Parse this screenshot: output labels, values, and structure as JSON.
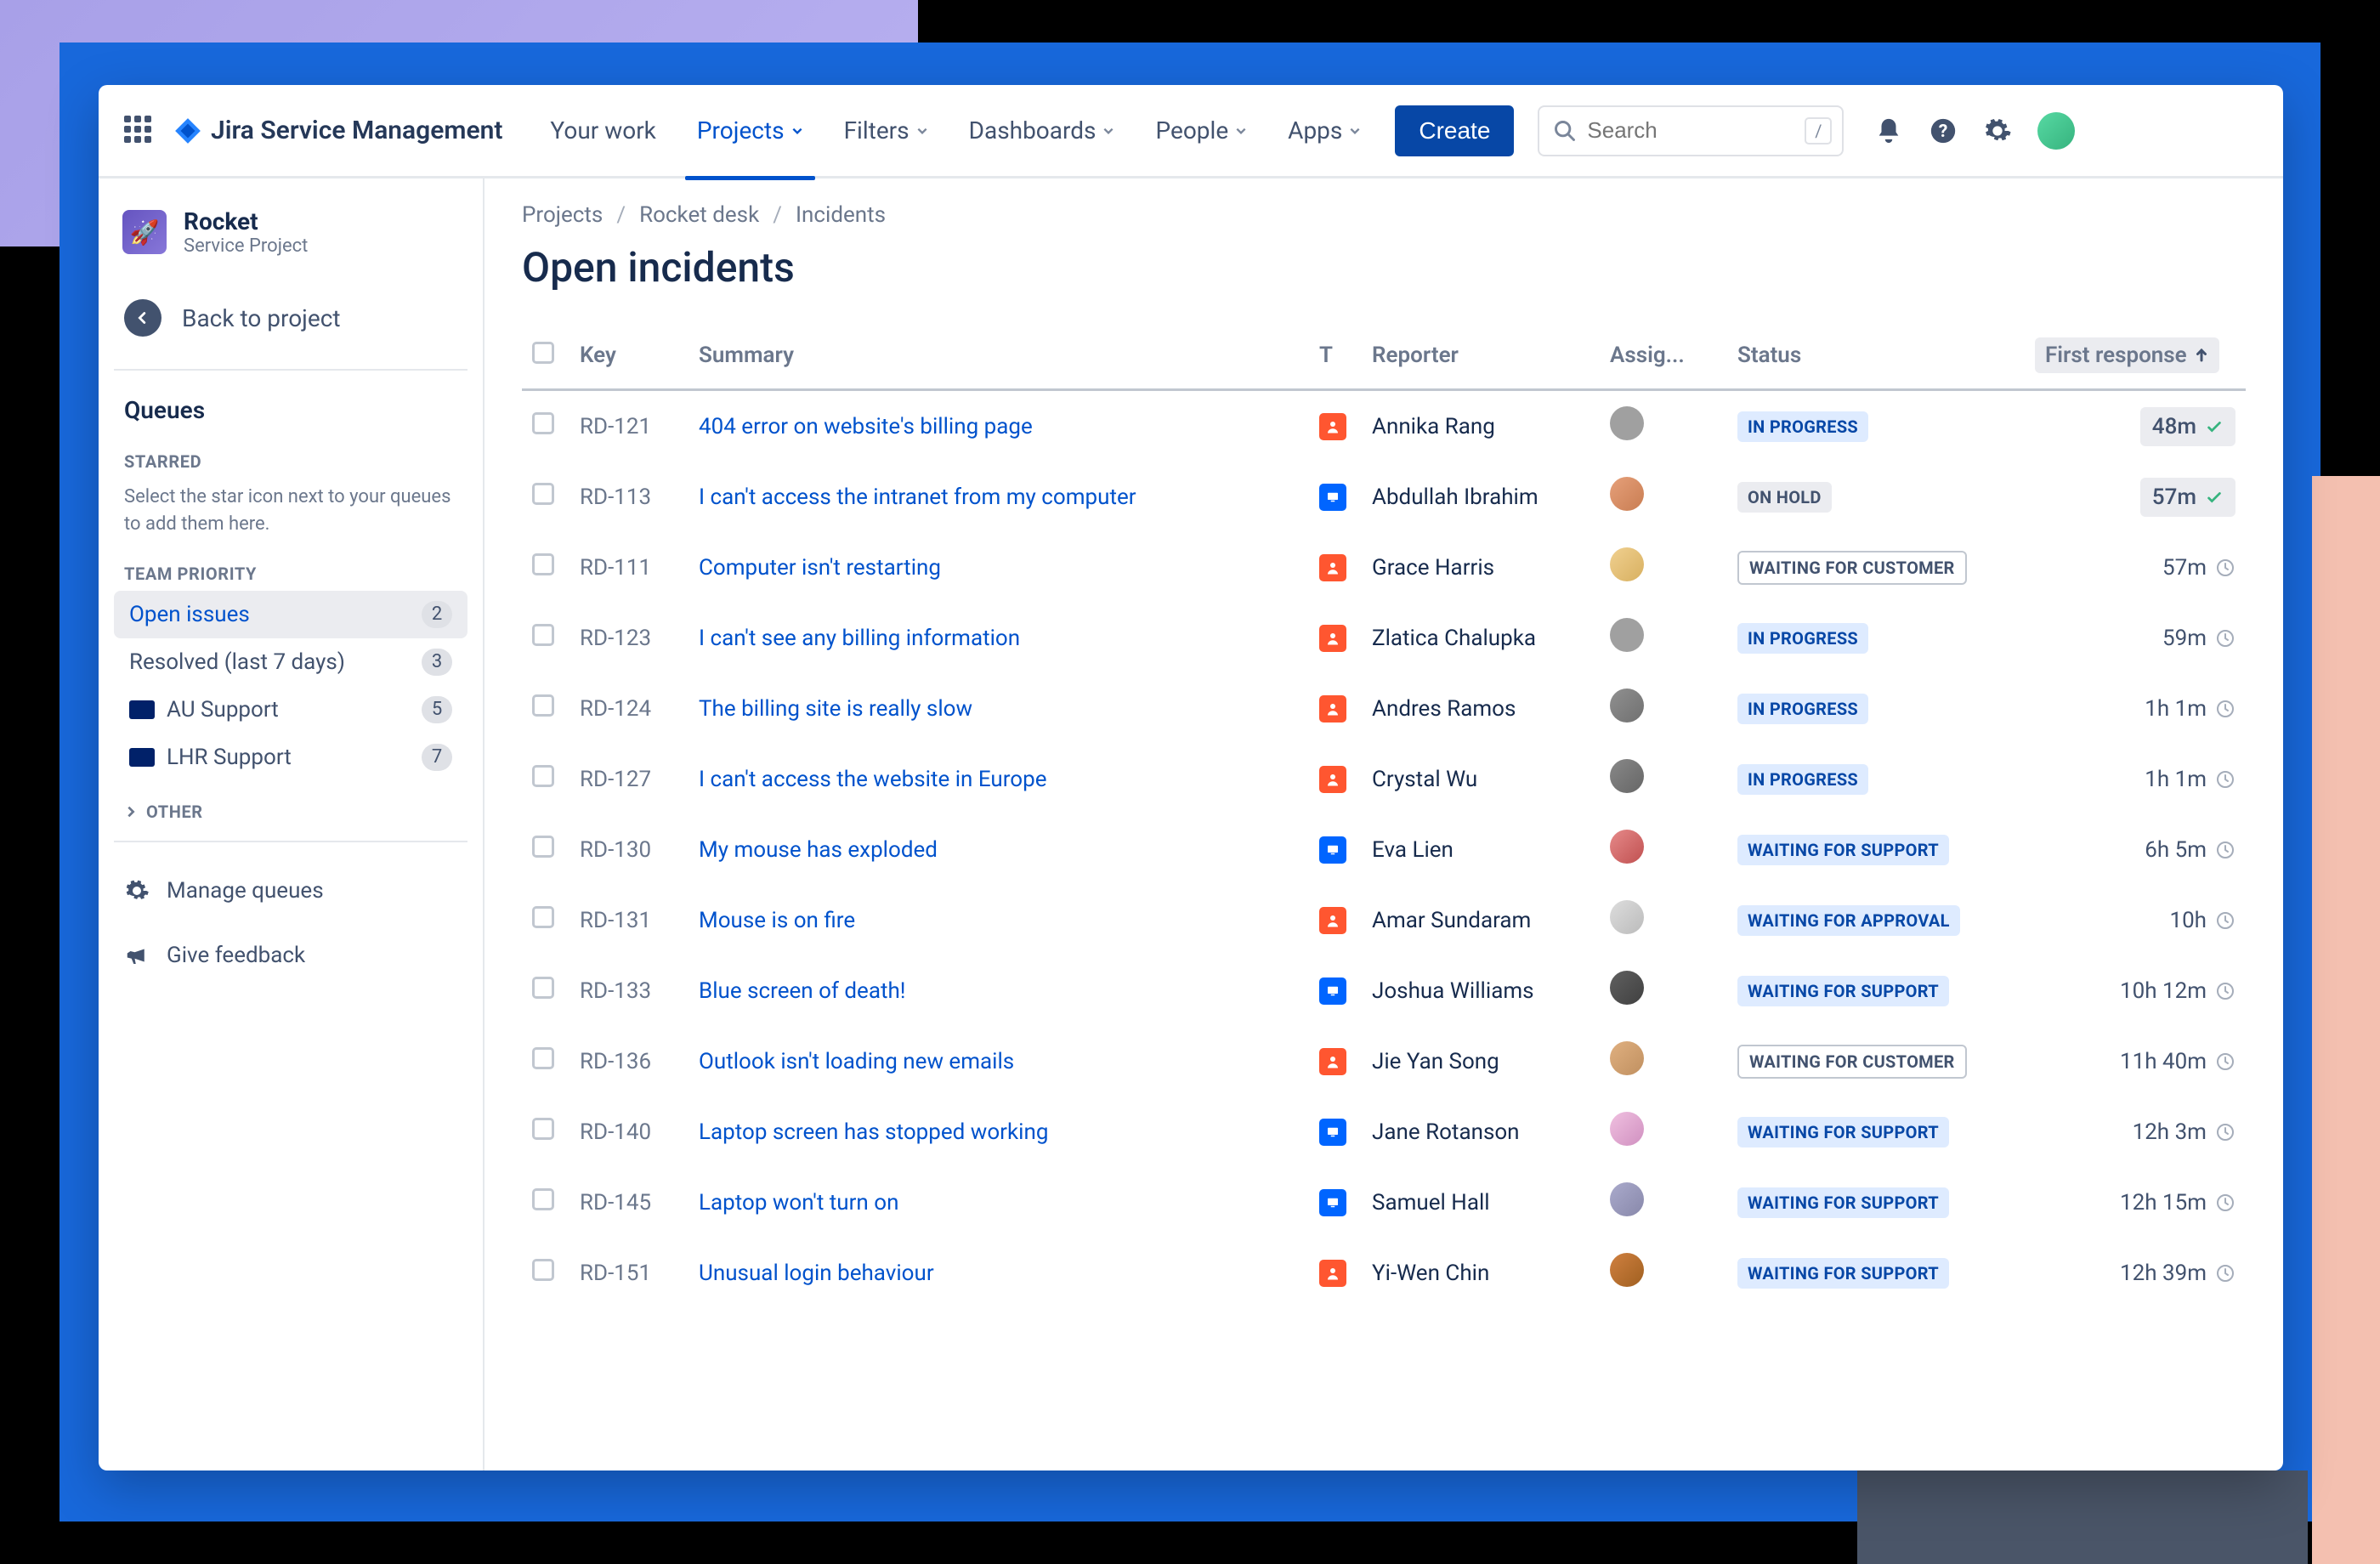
{
  "brand": "Jira Service Management",
  "nav": {
    "your_work": "Your work",
    "projects": "Projects",
    "filters": "Filters",
    "dashboards": "Dashboards",
    "people": "People",
    "apps": "Apps",
    "create": "Create"
  },
  "search": {
    "placeholder": "Search",
    "shortcut": "/"
  },
  "sidebar": {
    "project_name": "Rocket",
    "project_type": "Service Project",
    "back": "Back to project",
    "queues": "Queues",
    "starred_label": "STARRED",
    "starred_help": "Select the star icon next to your queues to add them here.",
    "team_priority_label": "TEAM PRIORITY",
    "other_label": "OTHER",
    "manage": "Manage queues",
    "feedback": "Give feedback",
    "items": [
      {
        "label": "Open issues",
        "count": "2",
        "flag": ""
      },
      {
        "label": "Resolved (last 7 days)",
        "count": "3",
        "flag": ""
      },
      {
        "label": "AU Support",
        "count": "5",
        "flag": "au"
      },
      {
        "label": "LHR Support",
        "count": "7",
        "flag": "uk"
      }
    ]
  },
  "breadcrumbs": [
    "Projects",
    "Rocket desk",
    "Incidents"
  ],
  "page_title": "Open incidents",
  "columns": {
    "key": "Key",
    "summary": "Summary",
    "t": "T",
    "reporter": "Reporter",
    "assignee": "Assig...",
    "status": "Status",
    "first_response": "First response"
  },
  "status_labels": {
    "in_progress": "IN PROGRESS",
    "on_hold": "ON HOLD",
    "waiting_customer": "WAITING FOR CUSTOMER",
    "waiting_support": "WAITING FOR SUPPORT",
    "waiting_approval": "WAITING FOR APPROVAL"
  },
  "rows": [
    {
      "key": "RD-121",
      "summary": "404 error on website's billing page",
      "type": "orange",
      "reporter": "Annika Rang",
      "assignee_gray": true,
      "av": "av-c1",
      "status": "in_progress",
      "first": "48m",
      "pill": true,
      "icon": "check"
    },
    {
      "key": "RD-113",
      "summary": "I can't access the intranet from my computer",
      "type": "blue",
      "reporter": "Abdullah Ibrahim",
      "assignee_gray": false,
      "av": "av-c2",
      "status": "on_hold",
      "first": "57m",
      "pill": true,
      "icon": "check"
    },
    {
      "key": "RD-111",
      "summary": "Computer isn't restarting",
      "type": "orange",
      "reporter": "Grace Harris",
      "assignee_gray": false,
      "av": "av-c3",
      "status": "waiting_customer",
      "first": "57m",
      "pill": false,
      "icon": "clock"
    },
    {
      "key": "RD-123",
      "summary": "I can't see any billing information",
      "type": "orange",
      "reporter": "Zlatica Chalupka",
      "assignee_gray": true,
      "av": "av-c1",
      "status": "in_progress",
      "first": "59m",
      "pill": false,
      "icon": "clock"
    },
    {
      "key": "RD-124",
      "summary": "The billing site is really slow",
      "type": "orange",
      "reporter": "Andres Ramos",
      "assignee_gray": true,
      "av": "av-c5",
      "status": "in_progress",
      "first": "1h 1m",
      "pill": false,
      "icon": "clock"
    },
    {
      "key": "RD-127",
      "summary": "I can't access the website in Europe",
      "type": "orange",
      "reporter": "Crystal Wu",
      "assignee_gray": true,
      "av": "av-c6",
      "status": "in_progress",
      "first": "1h 1m",
      "pill": false,
      "icon": "clock"
    },
    {
      "key": "RD-130",
      "summary": "My mouse has exploded",
      "type": "blue",
      "reporter": "Eva Lien",
      "assignee_gray": false,
      "av": "av-c7",
      "status": "waiting_support",
      "first": "6h 5m",
      "pill": false,
      "icon": "clock"
    },
    {
      "key": "RD-131",
      "summary": "Mouse is on fire",
      "type": "orange",
      "reporter": "Amar Sundaram",
      "assignee_gray": false,
      "av": "av-c8",
      "status": "waiting_approval",
      "first": "10h",
      "pill": false,
      "icon": "clock"
    },
    {
      "key": "RD-133",
      "summary": "Blue screen of death!",
      "type": "blue",
      "reporter": "Joshua Williams",
      "assignee_gray": false,
      "av": "av-c9",
      "status": "waiting_support",
      "first": "10h 12m",
      "pill": false,
      "icon": "clock"
    },
    {
      "key": "RD-136",
      "summary": "Outlook isn't loading new emails",
      "type": "orange",
      "reporter": "Jie Yan Song",
      "assignee_gray": false,
      "av": "av-c10",
      "status": "waiting_customer",
      "first": "11h 40m",
      "pill": false,
      "icon": "clock"
    },
    {
      "key": "RD-140",
      "summary": "Laptop screen has stopped working",
      "type": "blue",
      "reporter": "Jane Rotanson",
      "assignee_gray": false,
      "av": "av-c11",
      "status": "waiting_support",
      "first": "12h 3m",
      "pill": false,
      "icon": "clock"
    },
    {
      "key": "RD-145",
      "summary": "Laptop won't turn on",
      "type": "blue",
      "reporter": "Samuel Hall",
      "assignee_gray": false,
      "av": "av-c12",
      "status": "waiting_support",
      "first": "12h 15m",
      "pill": false,
      "icon": "clock"
    },
    {
      "key": "RD-151",
      "summary": "Unusual login behaviour",
      "type": "orange",
      "reporter": "Yi-Wen Chin",
      "assignee_gray": false,
      "av": "av-c13",
      "status": "waiting_support",
      "first": "12h 39m",
      "pill": false,
      "icon": "clock"
    }
  ]
}
